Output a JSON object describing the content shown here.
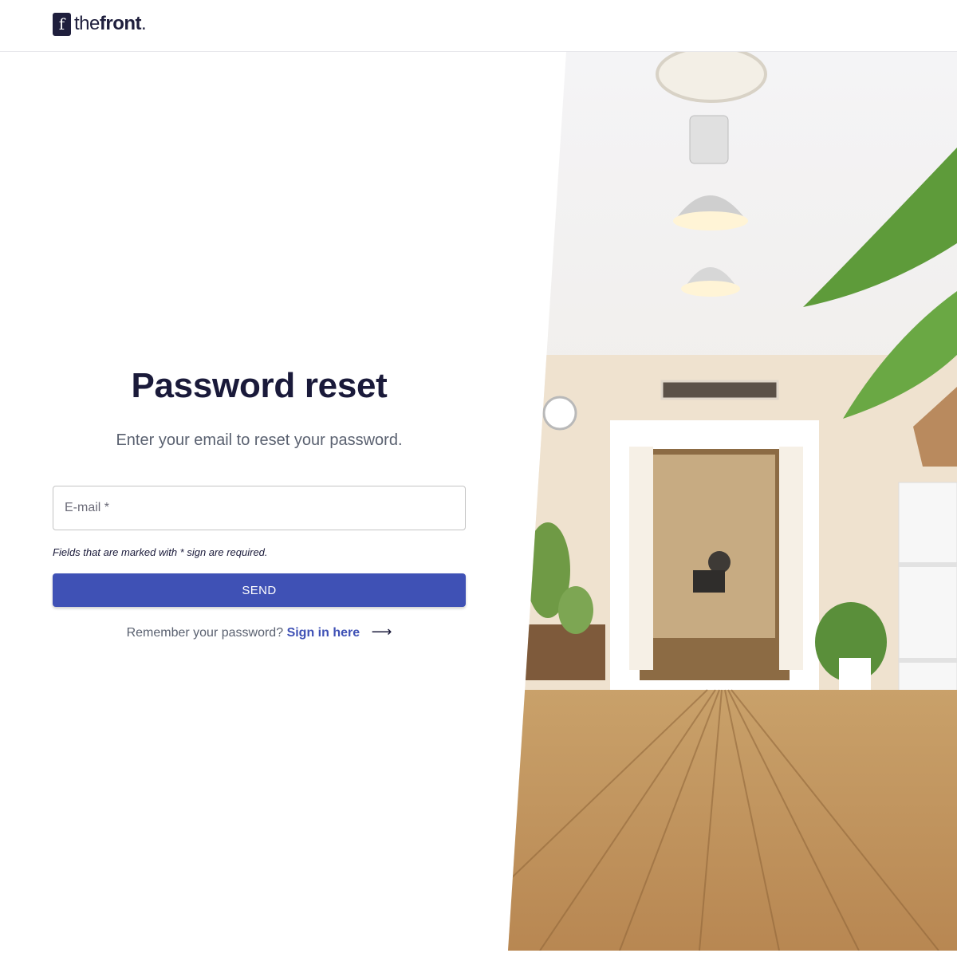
{
  "brand": {
    "logo_mark": "f",
    "name_light": "the",
    "name_bold": "front",
    "name_dot": "."
  },
  "reset": {
    "title": "Password reset",
    "subtitle": "Enter your email to reset your password.",
    "email_label": "E-mail *",
    "email_value": "",
    "required_hint": "Fields that are marked with * sign are required.",
    "send_label": "SEND",
    "remember_text": "Remember your password?",
    "signin_link": "Sign in here",
    "arrow_glyph": "⟶"
  },
  "colors": {
    "primary": "#3f51b5",
    "heading": "#1a1a3a",
    "muted": "#5a6170"
  },
  "hero_image": {
    "icon": "office-room-photo"
  }
}
